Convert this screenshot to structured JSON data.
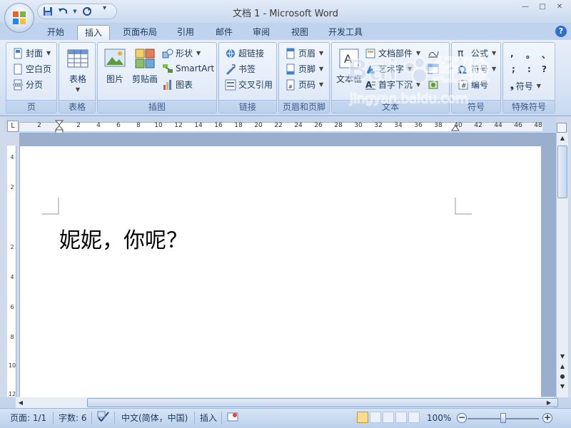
{
  "title": "文档 1 - Microsoft Word",
  "quick_access": [
    "save-icon",
    "undo-icon",
    "redo-icon"
  ],
  "tabs": [
    "开始",
    "插入",
    "页面布局",
    "引用",
    "邮件",
    "审阅",
    "视图",
    "开发工具"
  ],
  "active_tab": "插入",
  "ribbon": {
    "pages": {
      "label": "页",
      "items": [
        "封面",
        "空白页",
        "分页"
      ]
    },
    "tables": {
      "label": "表格",
      "button": "表格"
    },
    "illustrations": {
      "label": "插图",
      "picture": "图片",
      "clipart": "剪贴画",
      "shapes": "形状",
      "smartart": "SmartArt",
      "chart": "图表"
    },
    "links": {
      "label": "链接",
      "items": [
        "超链接",
        "书签",
        "交叉引用"
      ]
    },
    "header_footer": {
      "label": "页眉和页脚",
      "items": [
        "页眉",
        "页脚",
        "页码"
      ]
    },
    "text": {
      "label": "文本",
      "textbox": "文本框",
      "quickparts": "文档部件",
      "wordart": "艺术字",
      "dropcap": "首字下沉"
    },
    "symbols": {
      "label": "符号",
      "equation": "公式",
      "symbol": "符号",
      "numbering": "编号"
    },
    "special_symbols": {
      "label": "特殊符号",
      "marks": [
        ",",
        "。",
        "、",
        ";",
        ":",
        "?"
      ],
      "button": "符号"
    }
  },
  "ruler": {
    "h_numbers": [
      "2",
      "2",
      "4",
      "6",
      "8",
      "10",
      "12",
      "14",
      "16",
      "18",
      "20",
      "22",
      "24",
      "26",
      "28",
      "30",
      "32",
      "34",
      "36",
      "38",
      "40",
      "42",
      "44",
      "46",
      "48"
    ],
    "v_numbers": [
      "4",
      "2",
      "2",
      "4",
      "6",
      "8",
      "10",
      "12"
    ]
  },
  "document": {
    "text": "妮妮，你呢？"
  },
  "status": {
    "page": "页面: 1/1",
    "words": "字数: 6",
    "language": "中文(简体，中国)",
    "mode": "插入",
    "zoom": "100%"
  },
  "watermark": {
    "site": "jingyan.baidu.com",
    "brand": "Baidu",
    "suffix": "经验"
  }
}
